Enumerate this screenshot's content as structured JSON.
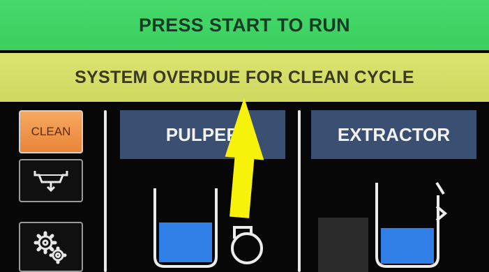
{
  "status": {
    "text": "PRESS START TO RUN"
  },
  "alert": {
    "text": "SYSTEM OVERDUE FOR CLEAN CYCLE"
  },
  "sidebar": {
    "clean_label": "CLEAN",
    "drain_icon": "drain-icon",
    "settings_icon": "gears-icon"
  },
  "tabs": {
    "pulper": "PULPER",
    "extractor": "EXTRACTOR"
  },
  "colors": {
    "status_bar": "#3ccf60",
    "alert_bar": "#cfd961",
    "tab": "#3b4f72",
    "clean_button": "#e98538",
    "water": "#2f7fe6",
    "arrow": "#f7f20a"
  },
  "pulper": {
    "fill_level": 0.55
  },
  "extractor": {
    "fill_level": 0.45
  }
}
